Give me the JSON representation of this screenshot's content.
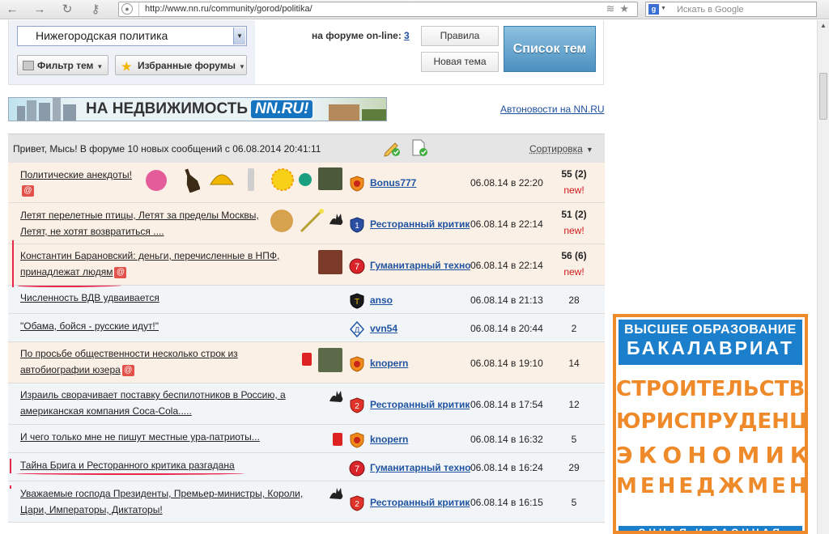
{
  "browser": {
    "url": "http://www.nn.ru/community/gorod/politika/",
    "search_placeholder": "Искать в Google",
    "search_engine_badge": "g"
  },
  "panel": {
    "forum_select": "Нижегородская политика",
    "filter_label": "Фильтр тем",
    "favorites_label": "Избранные форумы",
    "online_label": "на форуме on-line:",
    "online_count": "3",
    "rules_label": "Правила",
    "new_topic_label": "Новая тема",
    "topics_list_label": "Список тем"
  },
  "banner": {
    "text": "НА НЕДВИЖИМОСТЬ",
    "brand": "NN.RU!",
    "auto_link": "Автоновости на NN.RU"
  },
  "forum": {
    "greeting": "Привет, Мысь! В форуме 10 новых сообщений с 06.08.2014 20:41:11",
    "sort_label": "Сортировка",
    "at_symbol": "@",
    "rows": [
      {
        "lines": [
          "Политические анекдоты!"
        ],
        "at": true,
        "user": "Bonus777",
        "user_icon": "orange-shield-icon",
        "date": "06.08.14 в 22:20",
        "count": "55",
        "count_new": "(2)",
        "new": "new!"
      },
      {
        "lines": [
          "Летят перелетные птицы, Летят за пределы Москвы,",
          "Летят, не хотят возвратиться ...."
        ],
        "at": false,
        "user": "Ресторанный критик",
        "user_icon": "blue-shield-1-icon",
        "date": "06.08.14 в 22:14",
        "count": "51",
        "count_new": "(2)",
        "new": "new!"
      },
      {
        "lines": [
          "Константин Барановский: деньги, перечисленные в НПФ,",
          "принадлежат людям"
        ],
        "at": true,
        "user": "Гуманитарный техно",
        "user_icon": "red-circle-7-icon",
        "date": "06.08.14 в 22:14",
        "count": "56",
        "count_new": "(6)",
        "new": "new!"
      },
      {
        "lines": [
          "Численность ВДВ удваивается"
        ],
        "at": false,
        "user": "anso",
        "user_icon": "dark-shield-t-icon",
        "date": "06.08.14 в 21:13",
        "count": "28",
        "count_new": "",
        "new": ""
      },
      {
        "lines": [
          "\"Обама, бойся - русские идут!\""
        ],
        "at": false,
        "user": "vvn54",
        "user_icon": "dynamo-logo-icon",
        "date": "06.08.14 в 20:44",
        "count": "2",
        "count_new": "",
        "new": ""
      },
      {
        "lines": [
          "По просьбе общественности несколько строк из",
          "автобиографии юзера"
        ],
        "at": true,
        "user": "knopern",
        "user_icon": "orange-shield-icon",
        "date": "06.08.14 в 19:10",
        "count": "14",
        "count_new": "",
        "new": ""
      },
      {
        "lines": [
          "Израиль сворачивает поставку беспилотников в Россию, а",
          "американская компания Coca-Cola....."
        ],
        "at": false,
        "user": "Ресторанный критик",
        "user_icon": "red-shield-2-icon",
        "date": "06.08.14 в 17:54",
        "count": "12",
        "count_new": "",
        "new": ""
      },
      {
        "lines": [
          "И чего только мне не пишут местные ура-патриоты..."
        ],
        "at": false,
        "user": "knopern",
        "user_icon": "orange-shield-icon",
        "date": "06.08.14 в 16:32",
        "count": "5",
        "count_new": "",
        "new": ""
      },
      {
        "lines": [
          "Тайна Брига и Ресторанного критика разгадана"
        ],
        "at": false,
        "user": "Гуманитарный техно",
        "user_icon": "red-circle-7-icon",
        "date": "06.08.14 в 16:24",
        "count": "29",
        "count_new": "",
        "new": ""
      },
      {
        "lines": [
          "Уважаемые господа Президенты, Премьер-министры, Короли,",
          "Цари, Императоры, Диктаторы!"
        ],
        "at": false,
        "user": "Ресторанный критик",
        "user_icon": "red-shield-2-icon",
        "date": "06.08.14 в 16:15",
        "count": "5",
        "count_new": "",
        "new": ""
      }
    ]
  },
  "ad": {
    "top_line1": "ВЫСШЕЕ ОБРАЗОВАНИЕ",
    "top_line2": "БАКАЛАВРИАТ",
    "lines": [
      "СТРОИТЕЛЬСТВО",
      "ЮРИСПРУДЕНЦИЯ",
      "ЭКОНОМИКА",
      "МЕНЕДЖМЕНТ"
    ],
    "bottom": "ОЧНАЯ И ЗАОЧНАЯ",
    "accent": "#ef8a2b",
    "blue": "#1b7fcb"
  },
  "colors": {
    "link": "#2053a1",
    "new": "#d01a1a",
    "row_highlight": "#fbf0e6",
    "row_plain": "#f1f5f8",
    "annotation": "#e8274a"
  }
}
